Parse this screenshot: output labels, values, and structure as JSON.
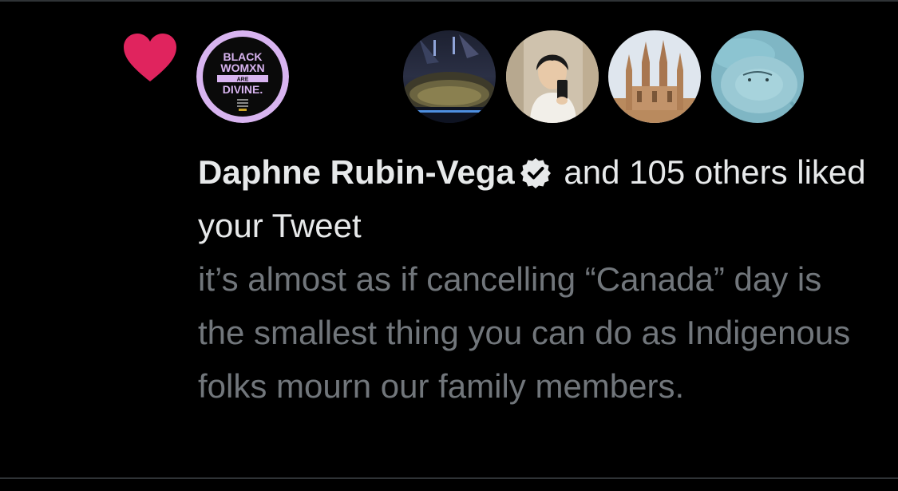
{
  "notification": {
    "type_icon": "heart-icon",
    "liker_name": "Daphne Rubin-Vega",
    "verified_icon": "verified-badge-icon",
    "action_text": "and 105 others liked your Tweet",
    "tweet_text": "it’s almost as if cancelling “Canada” day is the smallest thing you can do as Indigenous folks mourn our family members.",
    "avatars": [
      {
        "name": "avatar-black-womxn-are-divine",
        "lines": [
          "BLACK",
          "WOMXN",
          "ARE",
          "DIVINE."
        ]
      },
      {
        "name": "avatar-concert-stadium"
      },
      {
        "name": "avatar-mirror-selfie"
      },
      {
        "name": "avatar-gothic-towers"
      },
      {
        "name": "avatar-stingray"
      }
    ]
  },
  "colors": {
    "background": "#000000",
    "heart": "#f91880",
    "primary_text": "#e7e9ea",
    "secondary_text": "#71767b",
    "avatar_lavender": "#d8b4f0"
  }
}
